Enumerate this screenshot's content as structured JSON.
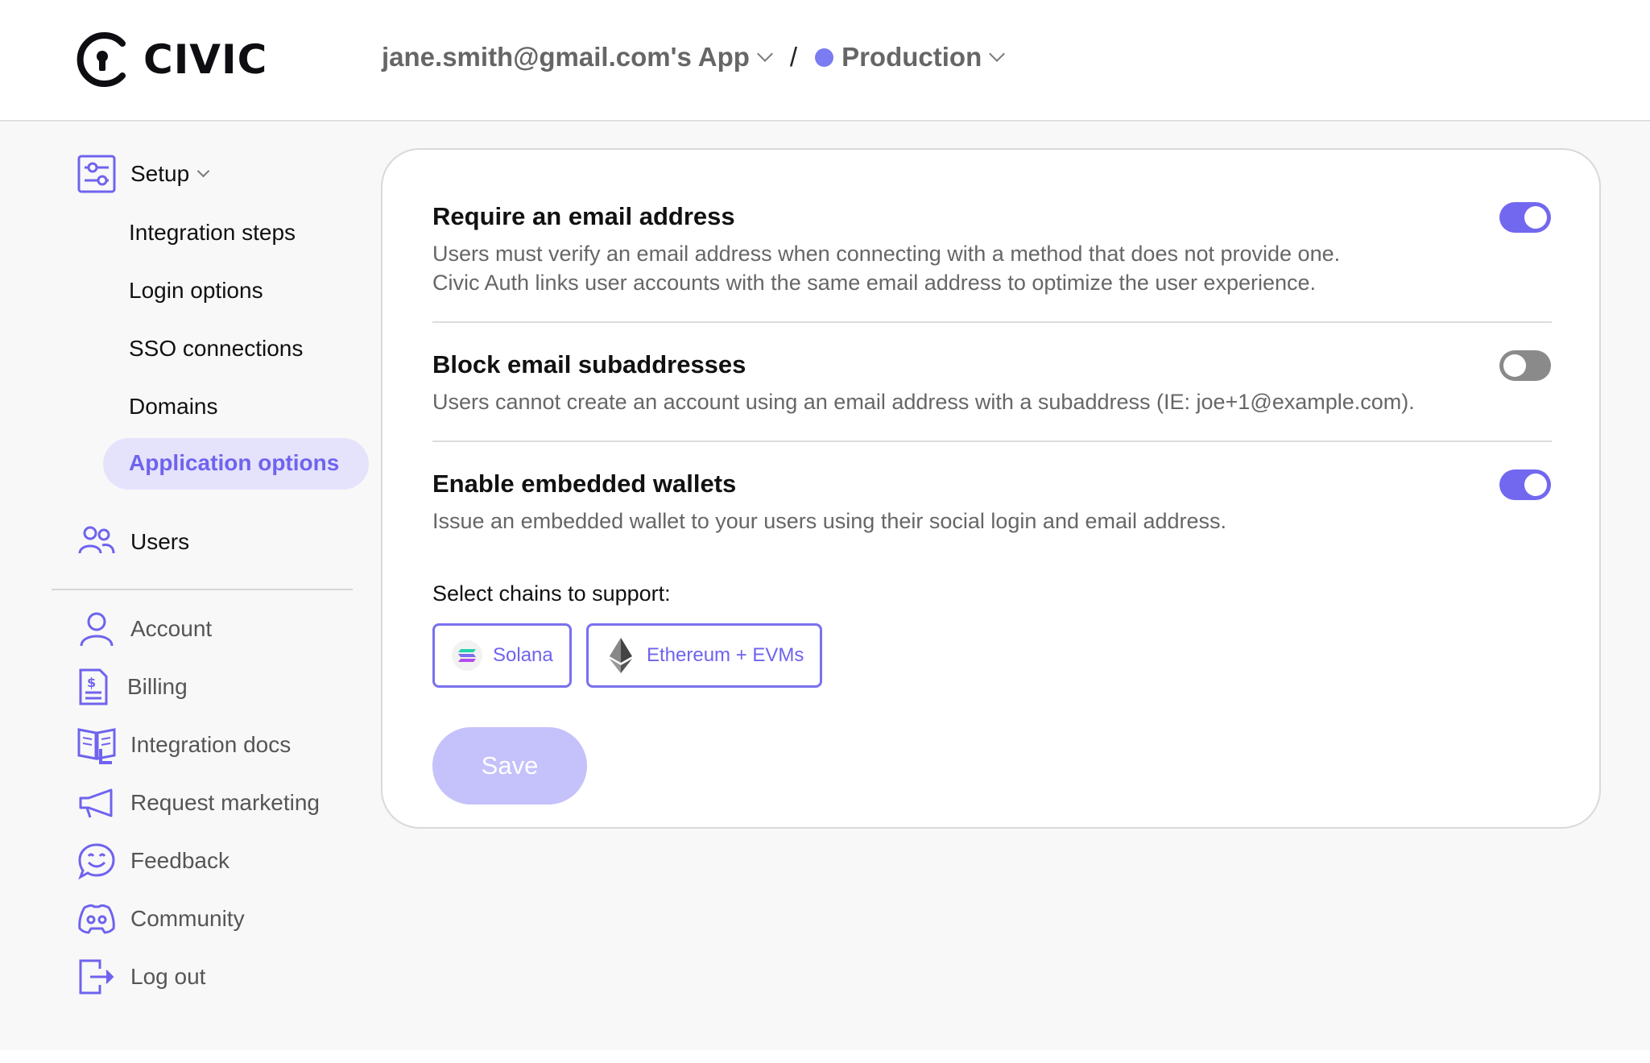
{
  "header": {
    "logo_text": "CIVIC",
    "app_name": "jane.smith@gmail.com's App",
    "separator": "/",
    "environment": "Production",
    "environment_color": "#7b7bf2"
  },
  "sidebar": {
    "setup": {
      "label": "Setup",
      "icon": "sliders-icon"
    },
    "setup_items": [
      {
        "label": "Integration steps"
      },
      {
        "label": "Login options"
      },
      {
        "label": "SSO connections"
      },
      {
        "label": "Domains"
      },
      {
        "label": "Application options",
        "active": true
      }
    ],
    "users": {
      "label": "Users",
      "icon": "users-icon"
    },
    "bottom_items": [
      {
        "label": "Account",
        "icon": "user-icon"
      },
      {
        "label": "Billing",
        "icon": "invoice-icon"
      },
      {
        "label": "Integration docs",
        "icon": "book-icon"
      },
      {
        "label": "Request marketing",
        "icon": "megaphone-icon"
      },
      {
        "label": "Feedback",
        "icon": "smile-chat-icon"
      },
      {
        "label": "Community",
        "icon": "discord-icon"
      },
      {
        "label": "Log out",
        "icon": "logout-icon"
      }
    ]
  },
  "settings": {
    "require_email": {
      "title": "Require an email address",
      "desc_line1": "Users must verify an email address when connecting with a method that does not provide one.",
      "desc_line2": "Civic Auth links user accounts with the same email address to optimize the user experience.",
      "enabled": true
    },
    "block_subaddresses": {
      "title": "Block email subaddresses",
      "desc": "Users cannot create an account using an email address with a subaddress (IE: joe+1@example.com).",
      "enabled": false
    },
    "embedded_wallets": {
      "title": "Enable embedded wallets",
      "desc": "Issue an embedded wallet to your users using their social login and email address.",
      "enabled": true
    },
    "chains_label": "Select chains to support:",
    "chains": [
      {
        "label": "Solana",
        "icon": "solana-icon"
      },
      {
        "label": "Ethereum + EVMs",
        "icon": "ethereum-icon"
      }
    ],
    "save_label": "Save"
  },
  "colors": {
    "accent": "#7268ef",
    "accent_light": "#e5e3fc",
    "save_disabled": "#c4c1fb"
  }
}
